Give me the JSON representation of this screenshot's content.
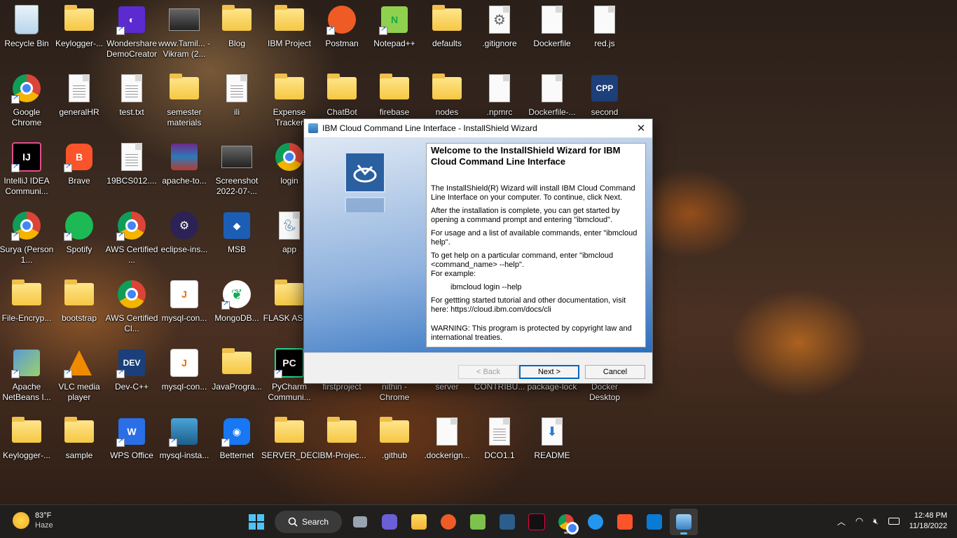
{
  "desktop": {
    "icons": [
      {
        "label": "Recycle Bin"
      },
      {
        "label": "Keylogger-..."
      },
      {
        "label": "Wondershare DemoCreator"
      },
      {
        "label": "www.Tamil... - Vikram (2..."
      },
      {
        "label": "Blog"
      },
      {
        "label": "IBM Project"
      },
      {
        "label": "Postman"
      },
      {
        "label": "Notepad++"
      },
      {
        "label": "defaults"
      },
      {
        "label": ".gitignore"
      },
      {
        "label": "Dockerfile"
      },
      {
        "label": "red.js"
      },
      {
        "label": "Google Chrome"
      },
      {
        "label": "generalHR"
      },
      {
        "label": "test.txt"
      },
      {
        "label": "semester materials"
      },
      {
        "label": "ili"
      },
      {
        "label": "Expense Tracker"
      },
      {
        "label": "ChatBot"
      },
      {
        "label": "firebase"
      },
      {
        "label": "nodes"
      },
      {
        "label": ".npmrc"
      },
      {
        "label": "Dockerfile-..."
      },
      {
        "label": "second"
      },
      {
        "label": "IntelliJ IDEA Communi..."
      },
      {
        "label": "Brave"
      },
      {
        "label": "19BCS012...."
      },
      {
        "label": "apache-to..."
      },
      {
        "label": "Screenshot 2022-07-..."
      },
      {
        "label": "login"
      },
      {
        "label": "Surya (Person 1..."
      },
      {
        "label": "Spotify"
      },
      {
        "label": "AWS Certified ..."
      },
      {
        "label": "eclipse-ins..."
      },
      {
        "label": "MSB"
      },
      {
        "label": "app"
      },
      {
        "label": "File-Encryp..."
      },
      {
        "label": "bootstrap"
      },
      {
        "label": "AWS Certified Cl..."
      },
      {
        "label": "mysql-con..."
      },
      {
        "label": "MongoDB..."
      },
      {
        "label": "FLASK ASS..."
      },
      {
        "label": "Apache NetBeans I..."
      },
      {
        "label": "VLC media player"
      },
      {
        "label": "Dev-C++"
      },
      {
        "label": "mysql-con..."
      },
      {
        "label": "JavaProgra..."
      },
      {
        "label": "PyCharm Communi..."
      },
      {
        "label": "firstproject"
      },
      {
        "label": "nithin - Chrome"
      },
      {
        "label": "server"
      },
      {
        "label": "CONTRIBU..."
      },
      {
        "label": "package-lock"
      },
      {
        "label": "Docker Desktop"
      },
      {
        "label": "Keylogger-..."
      },
      {
        "label": "sample"
      },
      {
        "label": "WPS Office"
      },
      {
        "label": "mysql-insta..."
      },
      {
        "label": "Betternet"
      },
      {
        "label": "SERVER_DEC"
      },
      {
        "label": "IBM-Projec..."
      },
      {
        "label": ".github"
      },
      {
        "label": ".dockerign..."
      },
      {
        "label": "DCO1.1"
      },
      {
        "label": "README"
      }
    ]
  },
  "dialog": {
    "title": "IBM Cloud Command Line Interface - InstallShield Wizard",
    "close_glyph": "✕",
    "heading": "Welcome to the InstallShield Wizard for IBM Cloud Command Line Interface",
    "paragraphs": [
      "The InstallShield(R) Wizard will install IBM Cloud Command Line Interface on your computer. To continue, click Next.",
      "After the installation is complete, you can get started by opening a command prompt and entering \"ibmcloud\".",
      "For usage and a list of available commands, enter \"ibmcloud help\".",
      "To get help on a particular command, enter \"ibmcloud <command_name> --help\".",
      "For example:",
      "ibmcloud login --help",
      "For gettting started tutorial and other documentation, visit here: https://cloud.ibm.com/docs/cli",
      "WARNING: This program is protected by copyright law and international treaties."
    ],
    "back_label": "< Back",
    "next_label": "Next >",
    "cancel_label": "Cancel"
  },
  "taskbar": {
    "weather_temp": "83°F",
    "weather_desc": "Haze",
    "search_label": "Search",
    "time": "12:48 PM",
    "date": "11/18/2022"
  },
  "colors": {
    "accent": "#0067c0",
    "taskbar": "#202020"
  }
}
